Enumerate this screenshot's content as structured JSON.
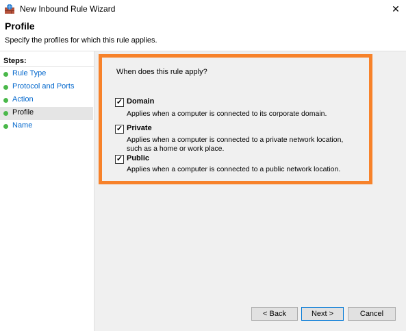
{
  "window": {
    "title": "New Inbound Rule Wizard",
    "close_glyph": "✕"
  },
  "header": {
    "title": "Profile",
    "subtitle": "Specify the profiles for which this rule applies."
  },
  "steps": {
    "label": "Steps:",
    "items": [
      {
        "label": "Rule Type"
      },
      {
        "label": "Protocol and Ports"
      },
      {
        "label": "Action"
      },
      {
        "label": "Profile"
      },
      {
        "label": "Name"
      }
    ]
  },
  "main": {
    "question": "When does this rule apply?",
    "profiles": [
      {
        "label": "Domain",
        "checked": true,
        "description": "Applies when a computer is connected to its corporate domain."
      },
      {
        "label": "Private",
        "checked": true,
        "description": "Applies when a computer is connected to a private network location, such as a home or work place."
      },
      {
        "label": "Public",
        "checked": true,
        "description": "Applies when a computer is connected to a public network location."
      }
    ]
  },
  "buttons": {
    "back": "< Back",
    "next": "Next >",
    "cancel": "Cancel"
  },
  "colors": {
    "highlight": "#f7822a",
    "step_dot": "#4ab84a",
    "link": "#0066cc"
  },
  "icons": {
    "app": "firewall-icon",
    "close": "close-icon",
    "step": "green-dot-icon",
    "checkbox": "checkmark-icon"
  }
}
